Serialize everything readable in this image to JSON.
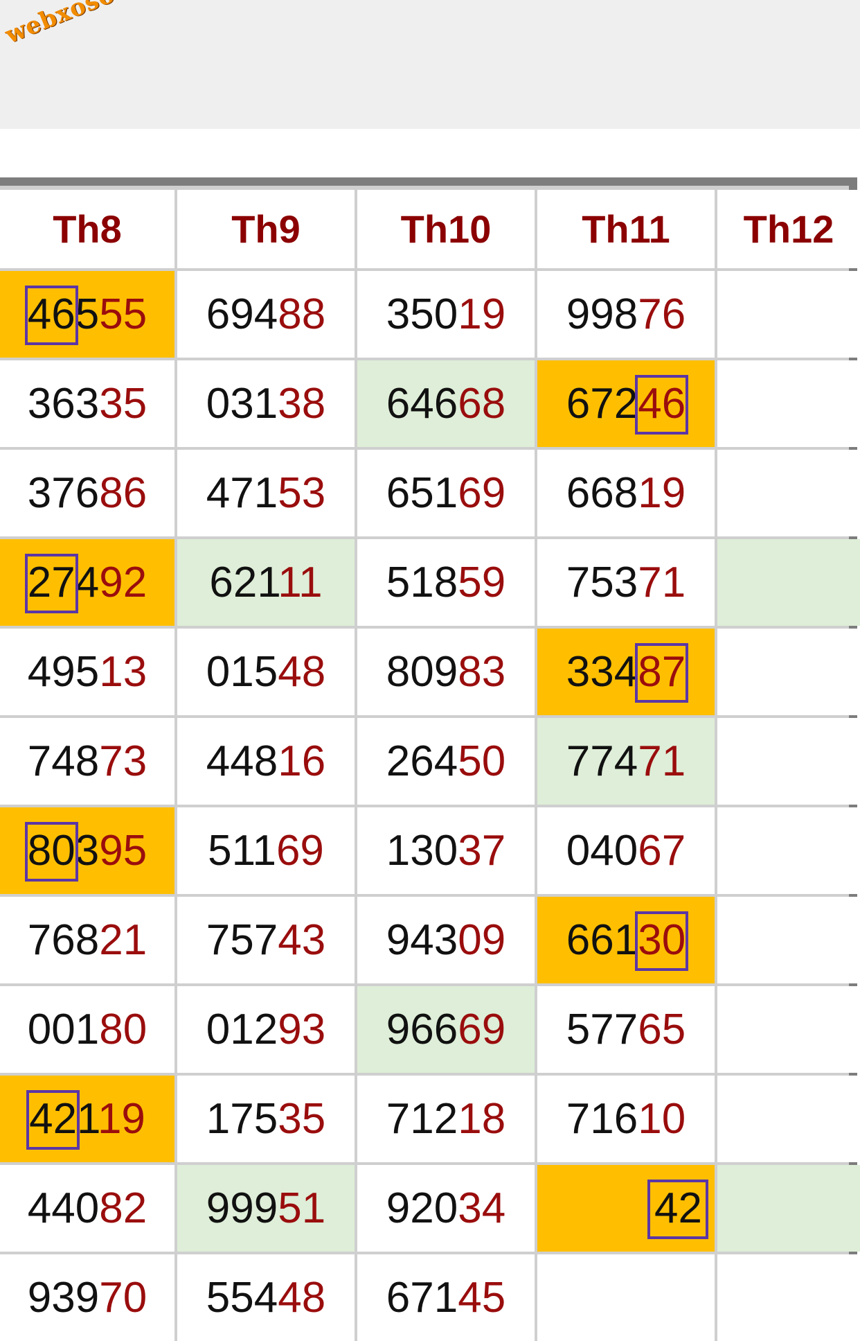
{
  "watermark": "webxoso.net",
  "columns": [
    "Th8",
    "Th9",
    "Th10",
    "Th11",
    "Th12"
  ],
  "rows": [
    [
      {
        "head": "465",
        "tail": "55",
        "bg": "orange",
        "box": [
          0,
          2
        ]
      },
      {
        "head": "694",
        "tail": "88"
      },
      {
        "head": "350",
        "tail": "19"
      },
      {
        "head": "998",
        "tail": "76"
      },
      {
        "head": "",
        "tail": ""
      }
    ],
    [
      {
        "head": "363",
        "tail": "35"
      },
      {
        "head": "031",
        "tail": "38"
      },
      {
        "head": "646",
        "tail": "68",
        "bg": "green"
      },
      {
        "head": "672",
        "tail": "46",
        "bg": "orange",
        "box": [
          3,
          5
        ]
      },
      {
        "head": "",
        "tail": ""
      }
    ],
    [
      {
        "head": "376",
        "tail": "86"
      },
      {
        "head": "471",
        "tail": "53"
      },
      {
        "head": "651",
        "tail": "69"
      },
      {
        "head": "668",
        "tail": "19"
      },
      {
        "head": "",
        "tail": ""
      }
    ],
    [
      {
        "head": "274",
        "tail": "92",
        "bg": "orange",
        "box": [
          0,
          2
        ]
      },
      {
        "head": "621",
        "tail": "11",
        "bg": "green"
      },
      {
        "head": "518",
        "tail": "59"
      },
      {
        "head": "753",
        "tail": "71"
      },
      {
        "head": "",
        "tail": "",
        "bg": "green"
      }
    ],
    [
      {
        "head": "495",
        "tail": "13"
      },
      {
        "head": "015",
        "tail": "48"
      },
      {
        "head": "809",
        "tail": "83"
      },
      {
        "head": "334",
        "tail": "87",
        "bg": "orange",
        "box": [
          3,
          5
        ]
      },
      {
        "head": "",
        "tail": ""
      }
    ],
    [
      {
        "head": "748",
        "tail": "73"
      },
      {
        "head": "448",
        "tail": "16"
      },
      {
        "head": "264",
        "tail": "50"
      },
      {
        "head": "774",
        "tail": "71",
        "bg": "green"
      },
      {
        "head": "",
        "tail": ""
      }
    ],
    [
      {
        "head": "803",
        "tail": "95",
        "bg": "orange",
        "box": [
          0,
          2
        ]
      },
      {
        "head": "511",
        "tail": "69"
      },
      {
        "head": "130",
        "tail": "37"
      },
      {
        "head": "040",
        "tail": "67"
      },
      {
        "head": "",
        "tail": ""
      }
    ],
    [
      {
        "head": "768",
        "tail": "21"
      },
      {
        "head": "757",
        "tail": "43"
      },
      {
        "head": "943",
        "tail": "09"
      },
      {
        "head": "661",
        "tail": "30",
        "bg": "orange",
        "box": [
          3,
          5
        ]
      },
      {
        "head": "",
        "tail": ""
      }
    ],
    [
      {
        "head": "001",
        "tail": "80"
      },
      {
        "head": "012",
        "tail": "93"
      },
      {
        "head": "966",
        "tail": "69",
        "bg": "green"
      },
      {
        "head": "577",
        "tail": "65"
      },
      {
        "head": "",
        "tail": ""
      }
    ],
    [
      {
        "head": "421",
        "tail": "19",
        "bg": "orange",
        "box": [
          0,
          2
        ]
      },
      {
        "head": "175",
        "tail": "35"
      },
      {
        "head": "712",
        "tail": "18"
      },
      {
        "head": "716",
        "tail": "10"
      },
      {
        "head": "",
        "tail": ""
      }
    ],
    [
      {
        "head": "440",
        "tail": "82"
      },
      {
        "head": "999",
        "tail": "51",
        "bg": "green"
      },
      {
        "head": "920",
        "tail": "34"
      },
      {
        "head": "",
        "tail": "42",
        "bg": "orange",
        "plain": true,
        "box": [
          0,
          2
        ]
      },
      {
        "head": "",
        "tail": "",
        "bg": "green"
      }
    ],
    [
      {
        "head": "939",
        "tail": "70"
      },
      {
        "head": "554",
        "tail": "48"
      },
      {
        "head": "671",
        "tail": "45"
      },
      {
        "head": "",
        "tail": ""
      },
      {
        "head": "",
        "tail": ""
      }
    ]
  ]
}
